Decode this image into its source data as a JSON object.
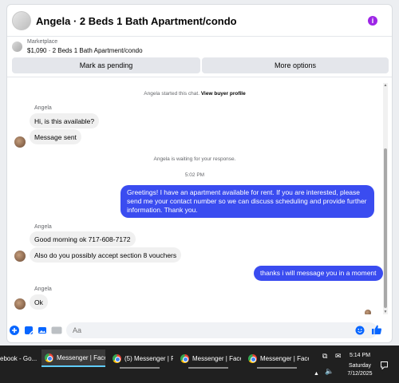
{
  "header": {
    "title": "Angela · 2 Beds 1 Bath Apartment/condo",
    "info_icon_glyph": "i",
    "accent_color": "#9d25e6"
  },
  "marketplace": {
    "label": "Marketplace",
    "item": "$1,090 · 2 Beds 1 Bath Apartment/condo",
    "mark_pending_label": "Mark as pending",
    "more_options_label": "More options"
  },
  "messages": {
    "started_prefix": "Angela started this chat.",
    "view_profile": "View buyer profile",
    "sender_name": "Angela",
    "msg1": "Hi, is this available?",
    "msg2": "Message sent",
    "waiting": "Angela is waiting for your response.",
    "timestamp": "5:02 PM",
    "out1": "Greetings! I have an apartment available for rent. If you are interested, please send me your contact number so we can discuss scheduling and provide further information. Thank you.",
    "msg3": "Good morning ok 717-608-7172",
    "msg4": "Also do you possibly accept section 8 vouchers",
    "out2": "thanks i will message you in a moment",
    "msg5": "Ok",
    "outgoing_color": "#3a4cf0"
  },
  "composer": {
    "placeholder": "Aa",
    "icons": [
      "plus-icon",
      "sticker-icon",
      "image-icon",
      "gif-icon",
      "emoji-icon",
      "thumbs-up-icon"
    ],
    "gif_label": "GIF"
  },
  "taskbar": {
    "items": [
      "ebook - Go...",
      "Messenger | Faceb...",
      "(5) Messenger | Fac...",
      "Messenger | Faceb...",
      "Messenger | Faceb..."
    ],
    "time": "5:14 PM",
    "day": "Saturday",
    "date": "7/12/2025"
  }
}
